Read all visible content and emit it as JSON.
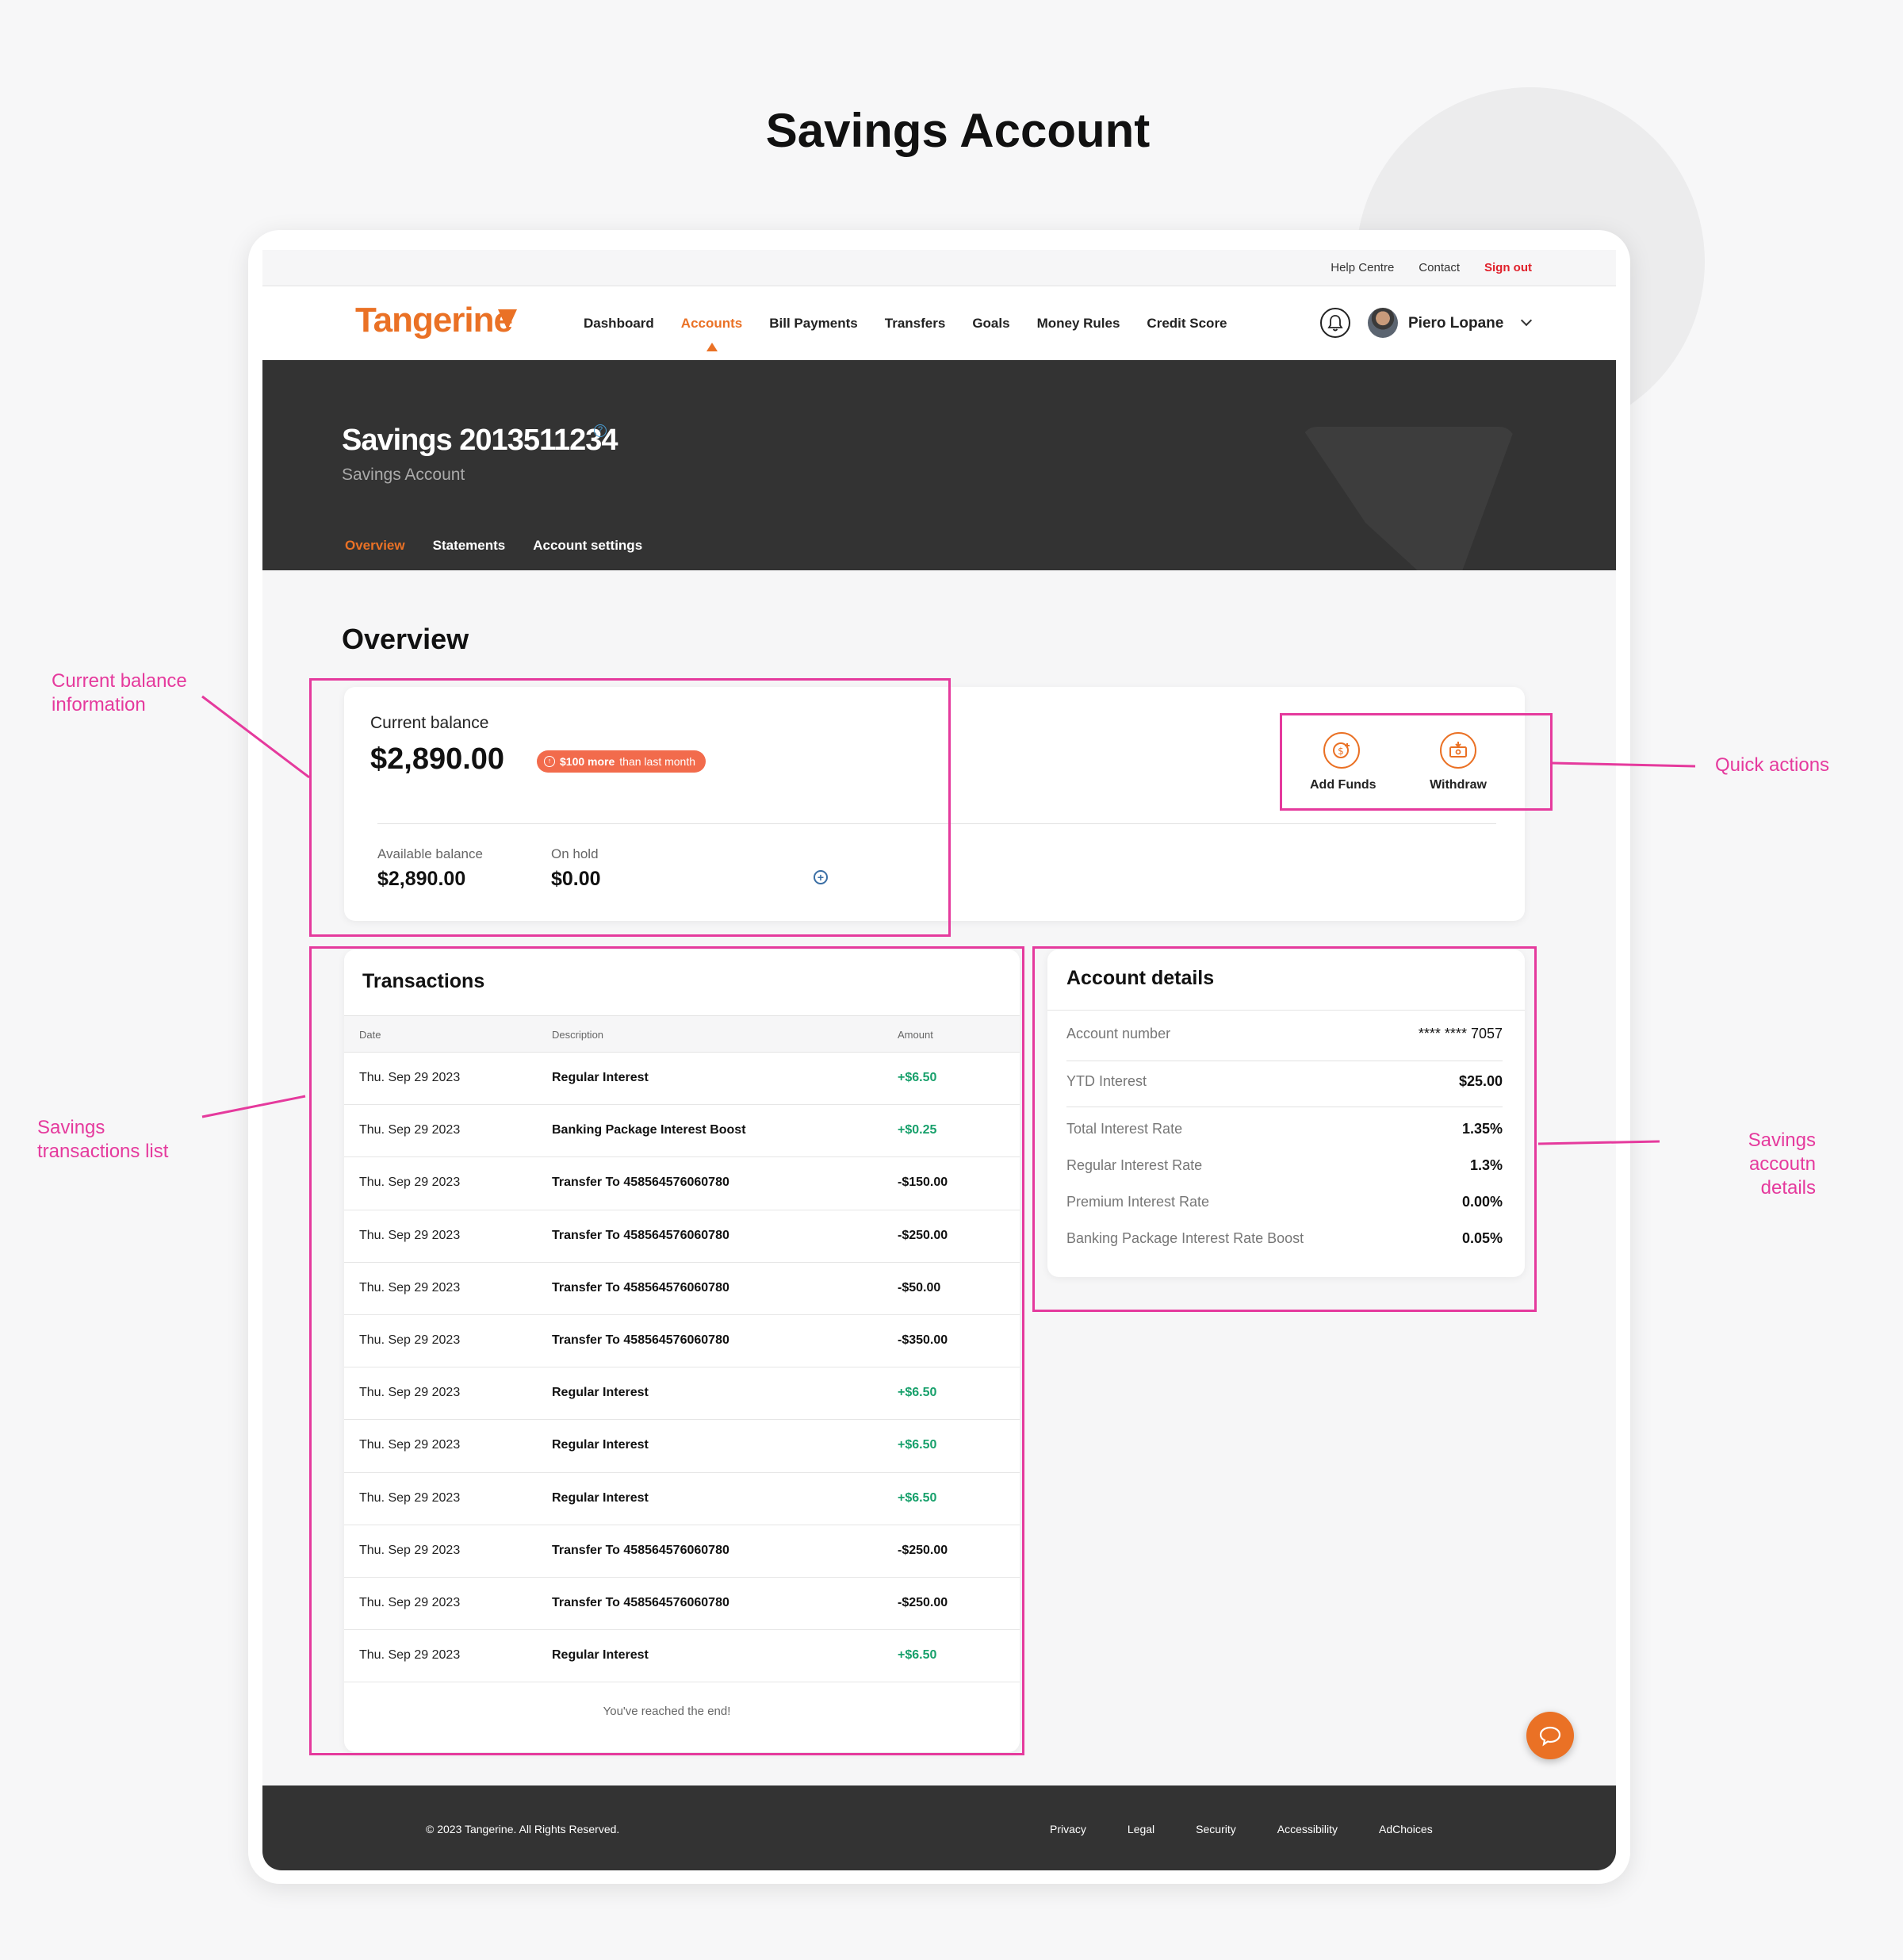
{
  "page_heading": "Savings Account",
  "util_bar": {
    "help": "Help Centre",
    "contact": "Contact",
    "signout": "Sign out"
  },
  "nav": {
    "logo": "Tangerine",
    "links": [
      "Dashboard",
      "Accounts",
      "Bill Payments",
      "Transfers",
      "Goals",
      "Money Rules",
      "Credit Score"
    ],
    "active_index": 1,
    "user_name": "Piero Lopane"
  },
  "hero": {
    "title": "Savings 2013511234",
    "subtitle": "Savings Account",
    "tabs": [
      "Overview",
      "Statements",
      "Account settings"
    ]
  },
  "overview_title": "Overview",
  "balance": {
    "label": "Current balance",
    "amount": "$2,890.00",
    "badge_bold": "$100 more",
    "badge_rest": "than last month",
    "available_label": "Available balance",
    "available_value": "$2,890.00",
    "hold_label": "On hold",
    "hold_value": "$0.00"
  },
  "quick_actions": {
    "add_funds": "Add Funds",
    "withdraw": "Withdraw"
  },
  "transactions": {
    "title": "Transactions",
    "columns": [
      "Date",
      "Description",
      "Amount"
    ],
    "rows": [
      {
        "date": "Thu. Sep 29 2023",
        "desc": "Regular Interest",
        "amount": "+$6.50",
        "positive": true
      },
      {
        "date": "Thu. Sep 29 2023",
        "desc": "Banking Package Interest Boost",
        "amount": "+$0.25",
        "positive": true
      },
      {
        "date": "Thu. Sep 29 2023",
        "desc": "Transfer To 458564576060780",
        "amount": "-$150.00",
        "positive": false
      },
      {
        "date": "Thu. Sep 29 2023",
        "desc": "Transfer To 458564576060780",
        "amount": "-$250.00",
        "positive": false
      },
      {
        "date": "Thu. Sep 29 2023",
        "desc": "Transfer To 458564576060780",
        "amount": "-$50.00",
        "positive": false
      },
      {
        "date": "Thu. Sep 29 2023",
        "desc": "Transfer To 458564576060780",
        "amount": "-$350.00",
        "positive": false
      },
      {
        "date": "Thu. Sep 29 2023",
        "desc": "Regular Interest",
        "amount": "+$6.50",
        "positive": true
      },
      {
        "date": "Thu. Sep 29 2023",
        "desc": "Regular Interest",
        "amount": "+$6.50",
        "positive": true
      },
      {
        "date": "Thu. Sep 29 2023",
        "desc": "Regular Interest",
        "amount": "+$6.50",
        "positive": true
      },
      {
        "date": "Thu. Sep 29 2023",
        "desc": "Transfer To 458564576060780",
        "amount": "-$250.00",
        "positive": false
      },
      {
        "date": "Thu. Sep 29 2023",
        "desc": "Transfer To 458564576060780",
        "amount": "-$250.00",
        "positive": false
      },
      {
        "date": "Thu. Sep 29 2023",
        "desc": "Regular Interest",
        "amount": "+$6.50",
        "positive": true
      }
    ],
    "end_text": "You've reached the end!"
  },
  "account_details": {
    "title": "Account details",
    "rows": [
      {
        "label": "Account number",
        "value": "**** **** 7057"
      },
      {
        "label": "YTD Interest",
        "value": "$25.00"
      },
      {
        "label": "Total Interest Rate",
        "value": "1.35%"
      },
      {
        "label": "Regular Interest Rate",
        "value": "1.3%"
      },
      {
        "label": "Premium Interest Rate",
        "value": "0.00%"
      },
      {
        "label": "Banking Package Interest Rate Boost",
        "value": "0.05%"
      }
    ]
  },
  "footer": {
    "copyright": "© 2023 Tangerine. All Rights Reserved.",
    "links": [
      "Privacy",
      "Legal",
      "Security",
      "Accessibility",
      "AdChoices"
    ]
  },
  "annotations": {
    "balance": [
      "Current balance",
      "information"
    ],
    "transactions": [
      "Savings",
      "transactions list"
    ],
    "quick_actions": "Quick actions",
    "details": [
      "Savings accoutn",
      "details"
    ]
  },
  "colors": {
    "brand_orange": "#ea7125",
    "annotation_pink": "#e53a9d",
    "positive_green": "#17a06b",
    "hero_dark": "#333333"
  },
  "icons": [
    "bell-icon",
    "avatar",
    "help-icon",
    "add-funds-icon",
    "withdraw-icon",
    "chat-icon",
    "chevron-down-icon",
    "plus-circle-icon",
    "arrow-up-circle-icon"
  ]
}
